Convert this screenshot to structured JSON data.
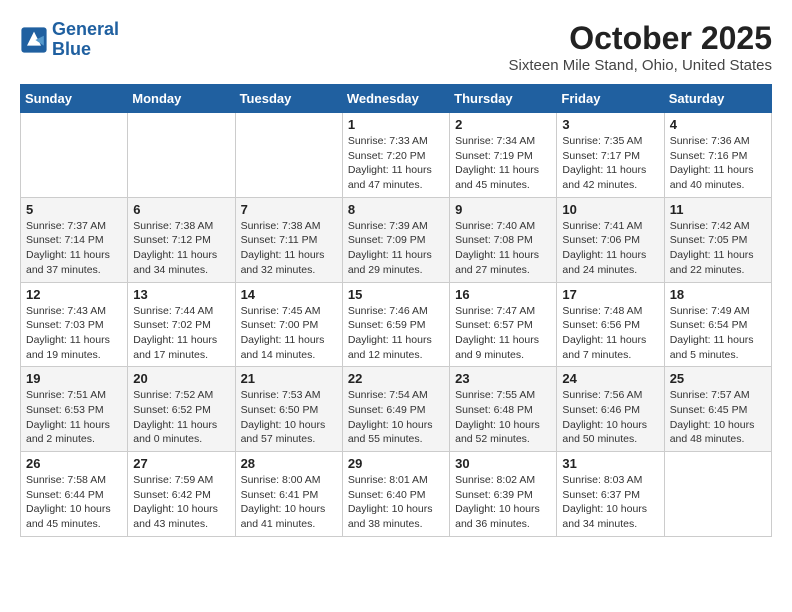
{
  "header": {
    "logo_line1": "General",
    "logo_line2": "Blue",
    "month": "October 2025",
    "location": "Sixteen Mile Stand, Ohio, United States"
  },
  "days_of_week": [
    "Sunday",
    "Monday",
    "Tuesday",
    "Wednesday",
    "Thursday",
    "Friday",
    "Saturday"
  ],
  "weeks": [
    [
      {
        "num": "",
        "info": ""
      },
      {
        "num": "",
        "info": ""
      },
      {
        "num": "",
        "info": ""
      },
      {
        "num": "1",
        "info": "Sunrise: 7:33 AM\nSunset: 7:20 PM\nDaylight: 11 hours\nand 47 minutes."
      },
      {
        "num": "2",
        "info": "Sunrise: 7:34 AM\nSunset: 7:19 PM\nDaylight: 11 hours\nand 45 minutes."
      },
      {
        "num": "3",
        "info": "Sunrise: 7:35 AM\nSunset: 7:17 PM\nDaylight: 11 hours\nand 42 minutes."
      },
      {
        "num": "4",
        "info": "Sunrise: 7:36 AM\nSunset: 7:16 PM\nDaylight: 11 hours\nand 40 minutes."
      }
    ],
    [
      {
        "num": "5",
        "info": "Sunrise: 7:37 AM\nSunset: 7:14 PM\nDaylight: 11 hours\nand 37 minutes."
      },
      {
        "num": "6",
        "info": "Sunrise: 7:38 AM\nSunset: 7:12 PM\nDaylight: 11 hours\nand 34 minutes."
      },
      {
        "num": "7",
        "info": "Sunrise: 7:38 AM\nSunset: 7:11 PM\nDaylight: 11 hours\nand 32 minutes."
      },
      {
        "num": "8",
        "info": "Sunrise: 7:39 AM\nSunset: 7:09 PM\nDaylight: 11 hours\nand 29 minutes."
      },
      {
        "num": "9",
        "info": "Sunrise: 7:40 AM\nSunset: 7:08 PM\nDaylight: 11 hours\nand 27 minutes."
      },
      {
        "num": "10",
        "info": "Sunrise: 7:41 AM\nSunset: 7:06 PM\nDaylight: 11 hours\nand 24 minutes."
      },
      {
        "num": "11",
        "info": "Sunrise: 7:42 AM\nSunset: 7:05 PM\nDaylight: 11 hours\nand 22 minutes."
      }
    ],
    [
      {
        "num": "12",
        "info": "Sunrise: 7:43 AM\nSunset: 7:03 PM\nDaylight: 11 hours\nand 19 minutes."
      },
      {
        "num": "13",
        "info": "Sunrise: 7:44 AM\nSunset: 7:02 PM\nDaylight: 11 hours\nand 17 minutes."
      },
      {
        "num": "14",
        "info": "Sunrise: 7:45 AM\nSunset: 7:00 PM\nDaylight: 11 hours\nand 14 minutes."
      },
      {
        "num": "15",
        "info": "Sunrise: 7:46 AM\nSunset: 6:59 PM\nDaylight: 11 hours\nand 12 minutes."
      },
      {
        "num": "16",
        "info": "Sunrise: 7:47 AM\nSunset: 6:57 PM\nDaylight: 11 hours\nand 9 minutes."
      },
      {
        "num": "17",
        "info": "Sunrise: 7:48 AM\nSunset: 6:56 PM\nDaylight: 11 hours\nand 7 minutes."
      },
      {
        "num": "18",
        "info": "Sunrise: 7:49 AM\nSunset: 6:54 PM\nDaylight: 11 hours\nand 5 minutes."
      }
    ],
    [
      {
        "num": "19",
        "info": "Sunrise: 7:51 AM\nSunset: 6:53 PM\nDaylight: 11 hours\nand 2 minutes."
      },
      {
        "num": "20",
        "info": "Sunrise: 7:52 AM\nSunset: 6:52 PM\nDaylight: 11 hours\nand 0 minutes."
      },
      {
        "num": "21",
        "info": "Sunrise: 7:53 AM\nSunset: 6:50 PM\nDaylight: 10 hours\nand 57 minutes."
      },
      {
        "num": "22",
        "info": "Sunrise: 7:54 AM\nSunset: 6:49 PM\nDaylight: 10 hours\nand 55 minutes."
      },
      {
        "num": "23",
        "info": "Sunrise: 7:55 AM\nSunset: 6:48 PM\nDaylight: 10 hours\nand 52 minutes."
      },
      {
        "num": "24",
        "info": "Sunrise: 7:56 AM\nSunset: 6:46 PM\nDaylight: 10 hours\nand 50 minutes."
      },
      {
        "num": "25",
        "info": "Sunrise: 7:57 AM\nSunset: 6:45 PM\nDaylight: 10 hours\nand 48 minutes."
      }
    ],
    [
      {
        "num": "26",
        "info": "Sunrise: 7:58 AM\nSunset: 6:44 PM\nDaylight: 10 hours\nand 45 minutes."
      },
      {
        "num": "27",
        "info": "Sunrise: 7:59 AM\nSunset: 6:42 PM\nDaylight: 10 hours\nand 43 minutes."
      },
      {
        "num": "28",
        "info": "Sunrise: 8:00 AM\nSunset: 6:41 PM\nDaylight: 10 hours\nand 41 minutes."
      },
      {
        "num": "29",
        "info": "Sunrise: 8:01 AM\nSunset: 6:40 PM\nDaylight: 10 hours\nand 38 minutes."
      },
      {
        "num": "30",
        "info": "Sunrise: 8:02 AM\nSunset: 6:39 PM\nDaylight: 10 hours\nand 36 minutes."
      },
      {
        "num": "31",
        "info": "Sunrise: 8:03 AM\nSunset: 6:37 PM\nDaylight: 10 hours\nand 34 minutes."
      },
      {
        "num": "",
        "info": ""
      }
    ]
  ]
}
